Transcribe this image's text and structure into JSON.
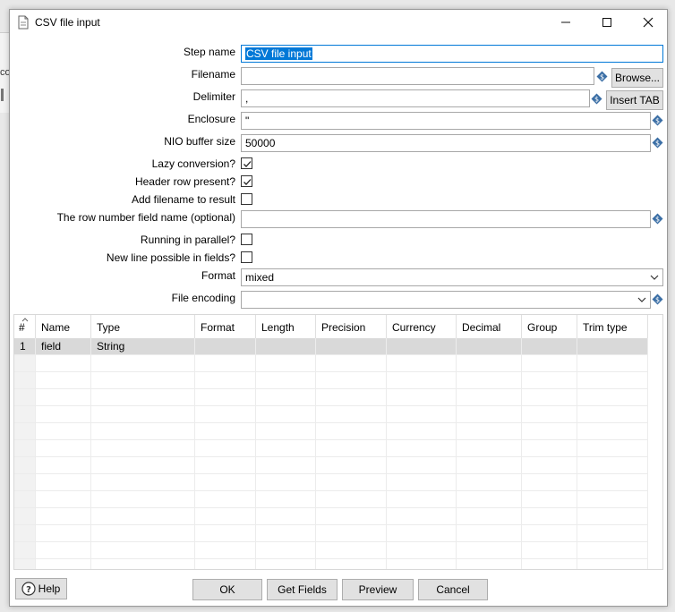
{
  "window": {
    "title": "CSV file input",
    "controls": {
      "minimize": "—",
      "maximize": "☐",
      "close": "✕"
    }
  },
  "form": {
    "step_name": {
      "label": "Step name",
      "value": "CSV file input"
    },
    "filename": {
      "label": "Filename",
      "value": "",
      "browse_label": "Browse..."
    },
    "delimiter": {
      "label": "Delimiter",
      "value": ",",
      "insert_tab_label": "Insert TAB"
    },
    "enclosure": {
      "label": "Enclosure",
      "value": "\""
    },
    "nio_buffer_size": {
      "label": "NIO buffer size",
      "value": "50000"
    },
    "lazy_conversion": {
      "label": "Lazy conversion?",
      "checked": true
    },
    "header_row_present": {
      "label": "Header row present?",
      "checked": true
    },
    "add_filename": {
      "label": "Add filename to result",
      "checked": false
    },
    "row_number_field": {
      "label": "The row number field name (optional)",
      "value": ""
    },
    "running_parallel": {
      "label": "Running in parallel?",
      "checked": false
    },
    "new_line_possible": {
      "label": "New line possible in fields?",
      "checked": false
    },
    "format": {
      "label": "Format",
      "value": "mixed"
    },
    "file_encoding": {
      "label": "File encoding",
      "value": ""
    }
  },
  "table": {
    "columns": [
      "#",
      "Name",
      "Type",
      "Format",
      "Length",
      "Precision",
      "Currency",
      "Decimal",
      "Group",
      "Trim type"
    ],
    "rows": [
      {
        "num": "1",
        "name": "field",
        "type": "String",
        "format": "",
        "length": "",
        "precision": "",
        "currency": "",
        "decimal": "",
        "group": "",
        "trim": ""
      }
    ]
  },
  "buttons": {
    "help": "Help",
    "ok": "OK",
    "get_fields": "Get Fields",
    "preview": "Preview",
    "cancel": "Cancel"
  },
  "icons": {
    "variable": "variable-dollar-icon",
    "help": "question-circle-icon",
    "title": "document-icon"
  },
  "colors": {
    "selection": "#0078d7",
    "selected_row": "#d9d9d9"
  }
}
